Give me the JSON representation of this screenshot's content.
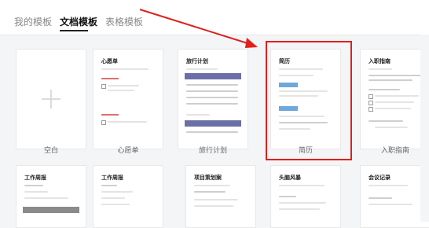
{
  "tabs": {
    "mine": "我的模板",
    "docs": "文档模板",
    "sheets": "表格模板"
  },
  "row1": {
    "blank_caption": "空白",
    "wish": {
      "title": "心愿单",
      "caption": "心愿单"
    },
    "travel": {
      "title": "旅行计划",
      "caption": "旅行计划"
    },
    "resume": {
      "title": "简历",
      "caption": "简历"
    },
    "onboard": {
      "title": "入职指南",
      "caption": "入职指南"
    }
  },
  "row2": {
    "weekly1": "工作周报",
    "weekly2": "工作周报",
    "project": "项目策划案",
    "brainstorm": "头脑风暴",
    "meeting": "会议记录"
  },
  "colors": {
    "accent_red": "#e0201a",
    "chip_blue": "#6fa8dc"
  }
}
